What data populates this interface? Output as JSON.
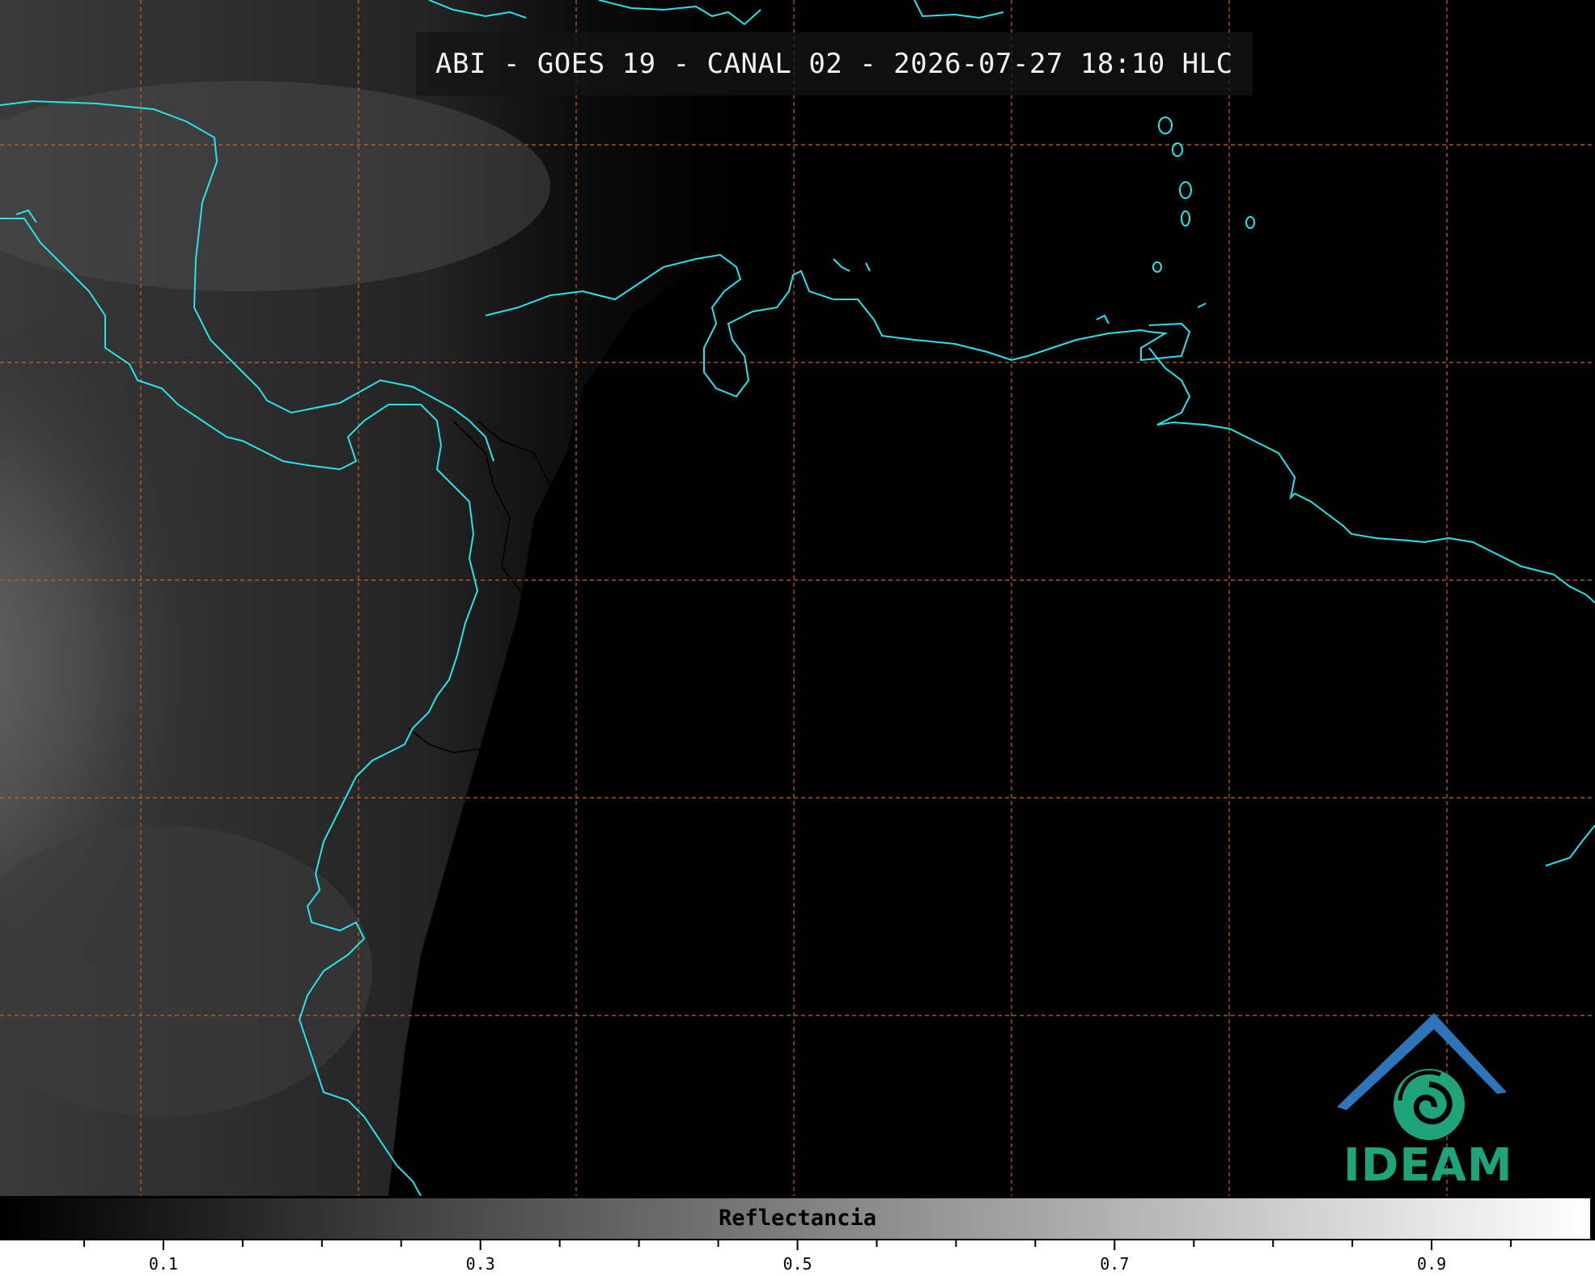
{
  "title": "ABI - GOES 19 - CANAL 02 - 2026-07-27 18:10 HLC",
  "logo": {
    "text": "IDEAM"
  },
  "colorbar": {
    "label": "Reflectancia",
    "range": [
      0,
      1
    ],
    "tick_labels": [
      "0.1",
      "0.3",
      "0.5",
      "0.7",
      "0.9"
    ],
    "tick_values": [
      0.1,
      0.3,
      0.5,
      0.7,
      0.9
    ],
    "minor_tick_step": 0.05,
    "gradient_start": "#000000",
    "gradient_end": "#ffffff"
  },
  "colors": {
    "coastline": "#29e3e8",
    "border": "#000000",
    "gridline": "#c0652a",
    "logo_blue": "#2f74b8",
    "logo_green": "#1fa37a"
  }
}
